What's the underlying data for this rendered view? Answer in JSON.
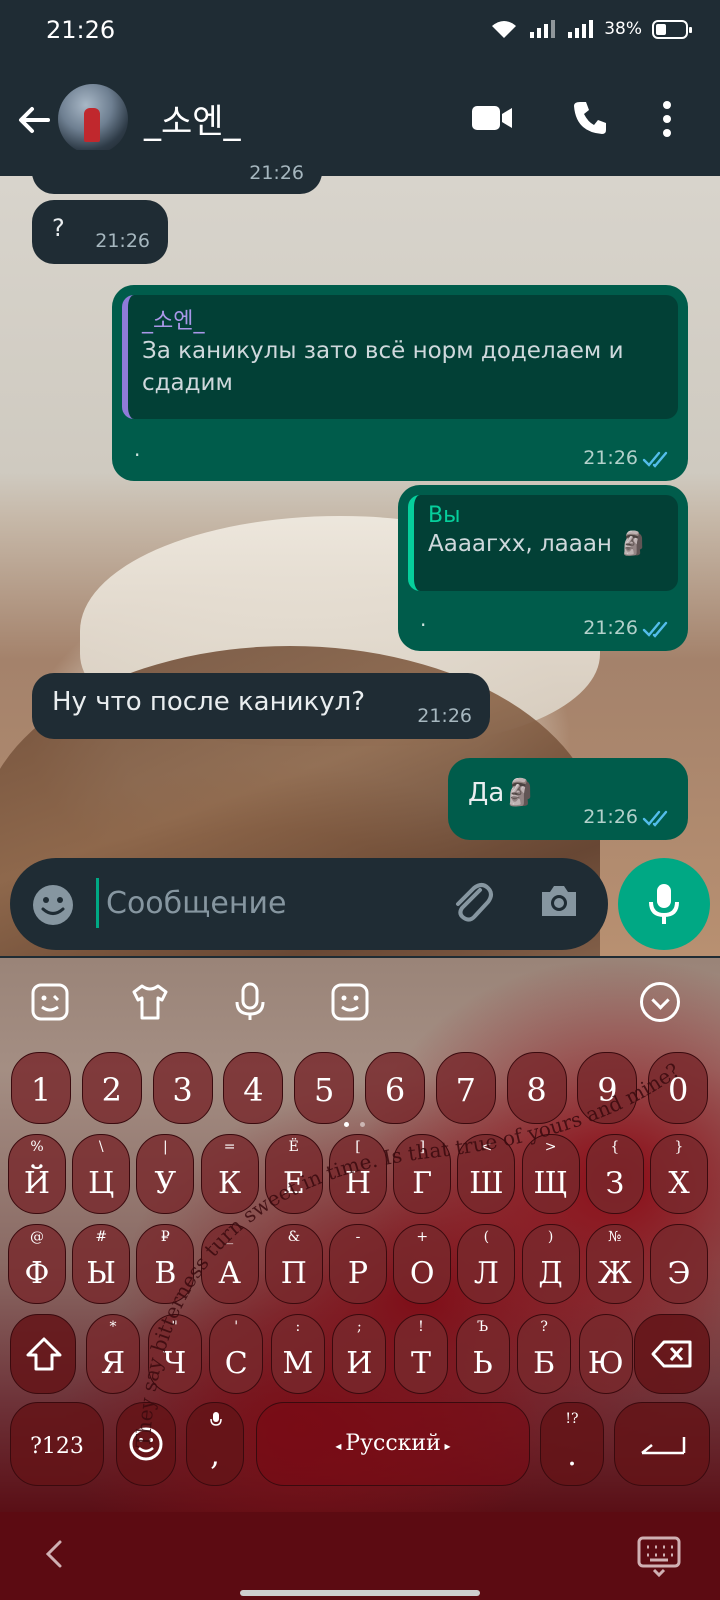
{
  "status": {
    "time": "21:26",
    "battery": "38%"
  },
  "header": {
    "contact_name": "_소엔_"
  },
  "messages": [
    {
      "time_partial": "21:26"
    },
    {
      "text": "?",
      "time": "21:26"
    },
    {
      "quote_name": "_소엔_",
      "quote_text": "За каникулы зато всё норм доделаем и сдадим",
      "text": "·",
      "time": "21:26"
    },
    {
      "quote_name": "Вы",
      "quote_text": "Аааагхх, лааан 🗿",
      "text": "·",
      "time": "21:26"
    },
    {
      "text": "Ну что после каникул?",
      "time": "21:26"
    },
    {
      "text": "Да🗿",
      "time": "21:26"
    }
  ],
  "input": {
    "placeholder": "Сообщение"
  },
  "keyboard": {
    "numbers": [
      "1",
      "2",
      "3",
      "4",
      "5",
      "6",
      "7",
      "8",
      "9",
      "0"
    ],
    "row1": {
      "keys": [
        "Й",
        "Ц",
        "У",
        "К",
        "Е",
        "Н",
        "Г",
        "Ш",
        "Щ",
        "З",
        "Х"
      ],
      "hints": [
        "%",
        "\\",
        "|",
        "=",
        "Ё",
        "[",
        "]",
        "<",
        ">",
        "{",
        "}"
      ]
    },
    "row2": {
      "keys": [
        "Ф",
        "Ы",
        "В",
        "А",
        "П",
        "Р",
        "О",
        "Л",
        "Д",
        "Ж",
        "Э"
      ],
      "hints": [
        "@",
        "#",
        "₽",
        "_",
        "&",
        "-",
        "+",
        "(",
        ")",
        "№",
        ""
      ]
    },
    "row3": {
      "keys": [
        "Я",
        "Ч",
        "С",
        "М",
        "И",
        "Т",
        "Ь",
        "Б",
        "Ю"
      ],
      "hints": [
        "*",
        "\"",
        "'",
        ":",
        ";",
        "!",
        "Ъ",
        "?",
        ""
      ]
    },
    "symbols_label": "?123",
    "comma": ",",
    "space_label": "Русский",
    "period": ".",
    "period_hint": "!?",
    "theme_text": "They say bitterness turn sweet in time. Is that true of yours and mine?"
  }
}
